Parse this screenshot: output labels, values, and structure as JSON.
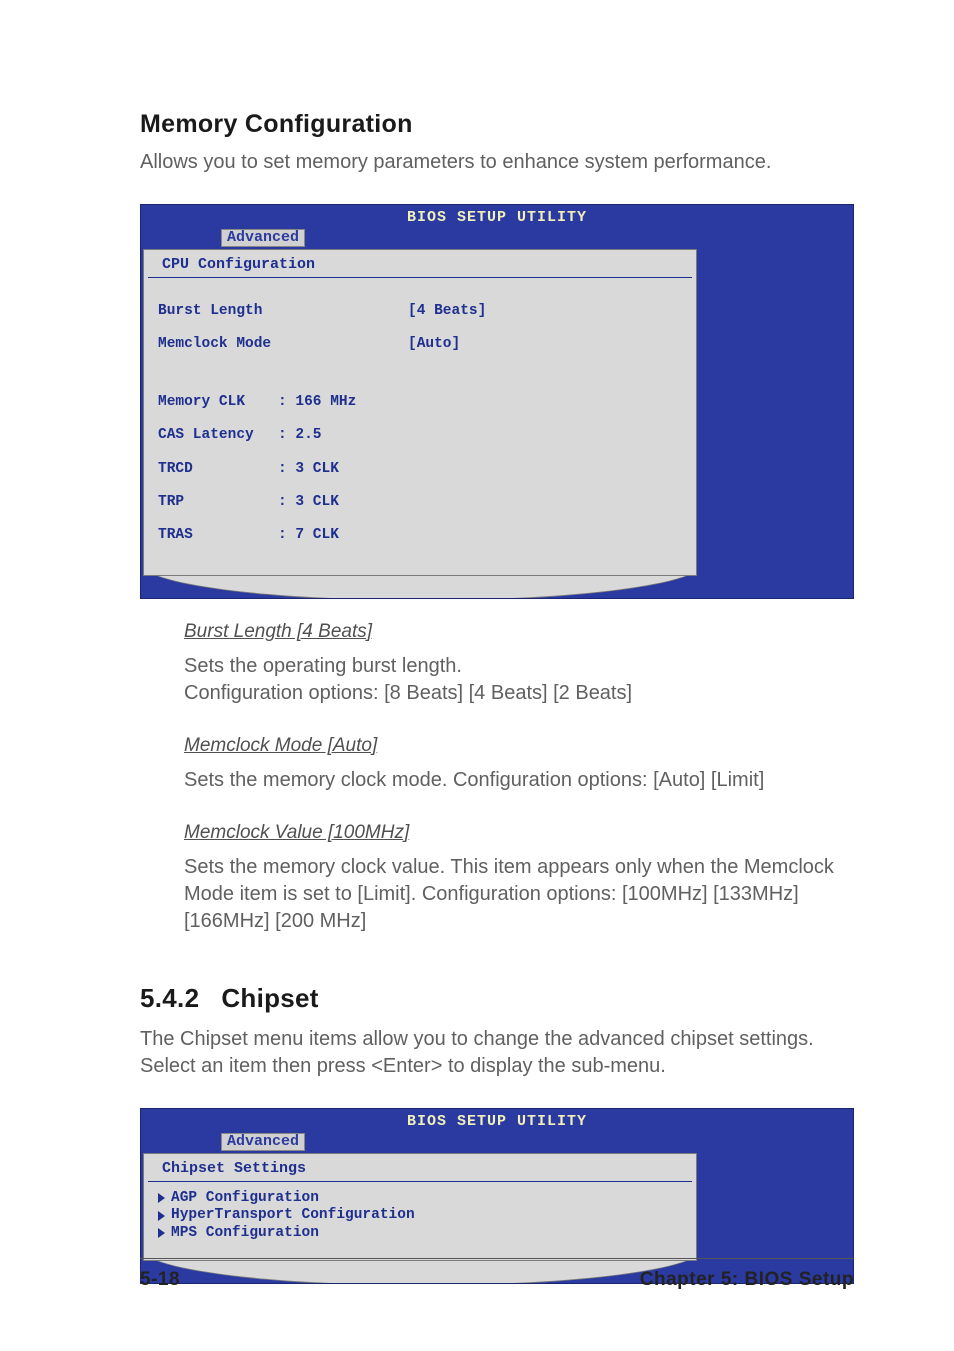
{
  "section1": {
    "title": "Memory Configuration",
    "intro": "Allows you to set memory parameters  to enhance system performance."
  },
  "bios1": {
    "utility_title": "BIOS SETUP UTILITY",
    "tab": "Advanced",
    "panel_title": "CPU Configuration",
    "rows": [
      {
        "label": "Burst Length",
        "value": "[4 Beats]"
      },
      {
        "label": "Memclock Mode",
        "value": "[Auto]"
      }
    ],
    "info": [
      {
        "label": "Memory CLK",
        "value": ": 166 MHz"
      },
      {
        "label": "CAS Latency",
        "value": ": 2.5"
      },
      {
        "label": "TRCD",
        "value": ": 3 CLK"
      },
      {
        "label": "TRP",
        "value": ": 3 CLK"
      },
      {
        "label": "TRAS",
        "value": ": 7 CLK"
      }
    ]
  },
  "opts": {
    "burst": {
      "heading": "Burst Length [4 Beats]",
      "line1": "Sets the operating burst length.",
      "line2": "Configuration options: [8 Beats] [4 Beats] [2 Beats]"
    },
    "memmode": {
      "heading": "Memclock Mode [Auto]",
      "line1": "Sets the memory clock mode. Configuration options: [Auto] [Limit]"
    },
    "memval": {
      "heading": "Memclock Value [100MHz]",
      "line1": "Sets the memory clock value. This item appears only when the Memclock Mode item is set to [Limit]. Configuration options: [100MHz] [133MHz] [166MHz] [200 MHz]"
    }
  },
  "section2": {
    "number": "5.4.2",
    "title": "Chipset",
    "intro": "The Chipset menu items allow you to change the advanced chipset settings. Select an item then press <Enter> to display the sub-menu."
  },
  "bios2": {
    "utility_title": "BIOS SETUP UTILITY",
    "tab": "Advanced",
    "panel_title": "Chipset Settings",
    "items": [
      "AGP Configuration",
      "HyperTransport Configuration",
      "MPS Configuration"
    ]
  },
  "footer": {
    "left": "5-18",
    "right": "Chapter 5: BIOS Setup"
  }
}
